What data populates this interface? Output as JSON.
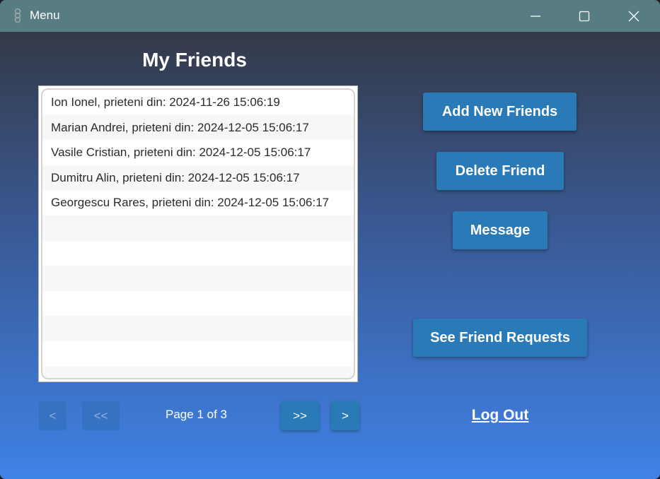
{
  "window": {
    "title": "Menu",
    "icons": [
      "app-icon",
      "minimize-icon",
      "maximize-icon",
      "close-icon"
    ]
  },
  "main": {
    "heading": "My Friends",
    "friends": [
      "Ion Ionel, prieteni din: 2024-11-26 15:06:19",
      "Marian Andrei, prieteni din: 2024-12-05 15:06:17",
      "Vasile Cristian, prieteni din: 2024-12-05 15:06:17",
      "Dumitru Alin, prieteni din: 2024-12-05 15:06:17",
      "Georgescu Rares, prieteni din: 2024-12-05 15:06:17",
      "",
      "",
      "",
      "",
      "",
      "",
      ""
    ]
  },
  "actions": {
    "add_friends": "Add New Friends",
    "delete_friend": "Delete Friend",
    "message": "Message",
    "see_requests": "See Friend Requests",
    "logout": "Log Out"
  },
  "pagination": {
    "prev": "<",
    "first": "<<",
    "page_label": "Page 1 of 3",
    "last": ">>",
    "next": ">",
    "current_page": 1,
    "total_pages": 3
  },
  "colors": {
    "titlebar": "#577c82",
    "button": "#2b7ab8",
    "gradient_top": "#343a48",
    "gradient_bottom": "#3f82e6"
  }
}
